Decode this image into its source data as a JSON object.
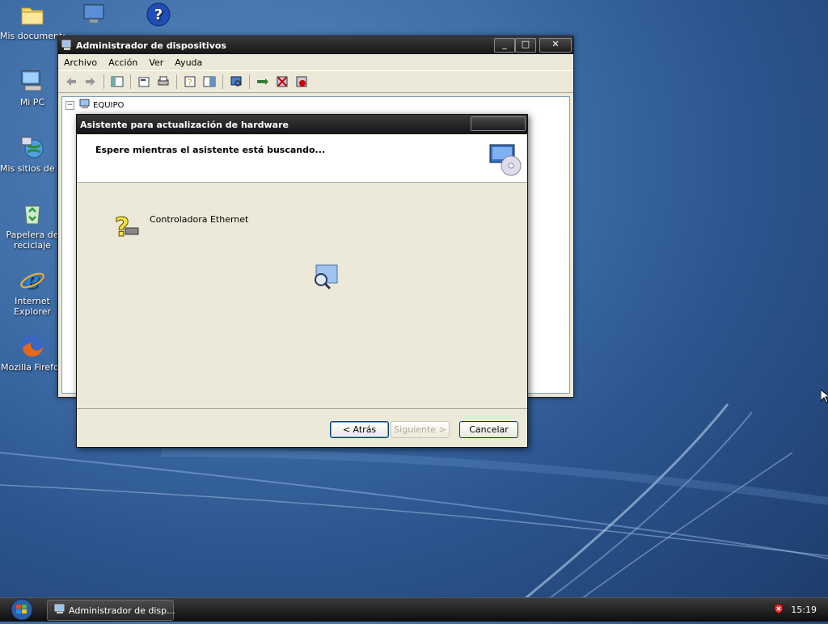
{
  "desktop": {
    "icons": [
      {
        "label": "Mis documentos",
        "icon": "folder-icon"
      },
      {
        "label": "Mi PC",
        "icon": "computer-icon"
      },
      {
        "label": "Mis sitios de re",
        "icon": "network-icon"
      },
      {
        "label": "Papelera de reciclaje",
        "icon": "recycle-bin-icon"
      },
      {
        "label": "Internet Explorer",
        "icon": "ie-icon"
      },
      {
        "label": "Mozilla Firefox",
        "icon": "firefox-icon"
      }
    ]
  },
  "devmgr": {
    "title": "Administrador de dispositivos",
    "menu": [
      "Archivo",
      "Acción",
      "Ver",
      "Ayuda"
    ],
    "tree_root": "EQUIPO"
  },
  "wizard": {
    "title": "Asistente para actualización de hardware",
    "heading": "Espere mientras el asistente está buscando...",
    "device": "Controladora Ethernet",
    "buttons": {
      "back": "< Atrás",
      "next": "Siguiente >",
      "cancel": "Cancelar"
    }
  },
  "taskbar": {
    "task_label": "Administrador de disp...",
    "clock": "15:19"
  }
}
